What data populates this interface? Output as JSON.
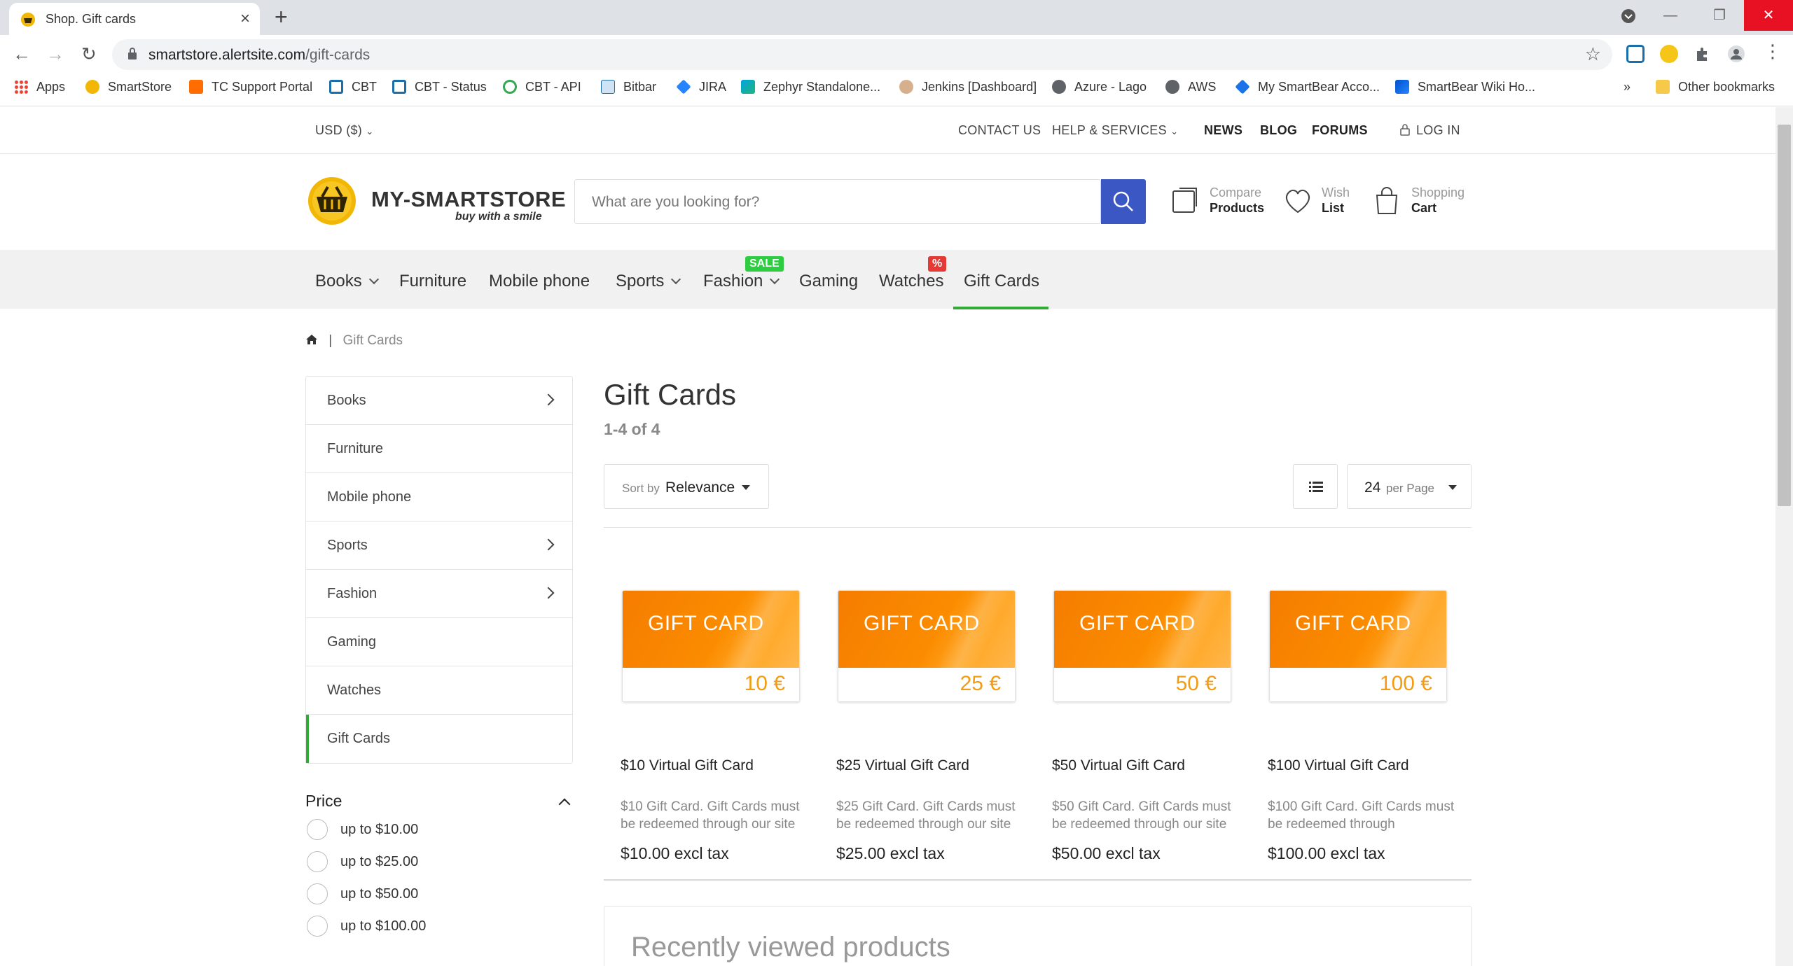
{
  "browser": {
    "tab_title": "Shop. Gift cards",
    "url_host": "smartstore.alertsite.com",
    "url_path": "/gift-cards",
    "bookmarks": [
      "Apps",
      "SmartStore",
      "TC Support Portal",
      "CBT",
      "CBT - Status",
      "CBT - API",
      "Bitbar",
      "JIRA",
      "Zephyr Standalone...",
      "Jenkins [Dashboard]",
      "Azure - Lago",
      "AWS",
      "My SmartBear Acco...",
      "SmartBear Wiki Ho..."
    ],
    "overflow": "»",
    "other_bookmarks": "Other bookmarks"
  },
  "topbar": {
    "currency": "USD ($)",
    "contact": "CONTACT US",
    "help": "HELP & SERVICES",
    "news": "NEWS",
    "blog": "BLOG",
    "forums": "FORUMS",
    "login": "LOG IN"
  },
  "header": {
    "logo_name": "MY-SMARTSTORE",
    "logo_tagline": "buy with a smile",
    "search_placeholder": "What are you looking for?",
    "compare_l1": "Compare",
    "compare_l2": "Products",
    "wish_l1": "Wish",
    "wish_l2": "List",
    "cart_l1": "Shopping",
    "cart_l2": "Cart"
  },
  "nav": {
    "books": "Books",
    "furniture": "Furniture",
    "mobile": "Mobile phone",
    "sports": "Sports",
    "fashion": "Fashion",
    "fashion_badge": "SALE",
    "gaming": "Gaming",
    "watches": "Watches",
    "watches_badge": "%",
    "giftcards": "Gift Cards"
  },
  "breadcrumb": {
    "sep": "|",
    "current": "Gift Cards"
  },
  "sidebar": {
    "items": [
      "Books",
      "Furniture",
      "Mobile phone",
      "Sports",
      "Fashion",
      "Gaming",
      "Watches",
      "Gift Cards"
    ]
  },
  "price_filter": {
    "title": "Price",
    "options": [
      "up to $10.00",
      "up to $25.00",
      "up to $50.00",
      "up to $100.00"
    ]
  },
  "main": {
    "title": "Gift Cards",
    "count": "1-4 of 4",
    "sort_prefix": "Sort by",
    "sort_value": "Relevance",
    "per_page_num": "24",
    "per_page_label": "per Page",
    "recent_title": "Recently viewed products"
  },
  "card_text": "GIFT CARD",
  "products": [
    {
      "amount": "10 €",
      "name": "$10 Virtual Gift Card",
      "desc": "$10 Gift Card. Gift Cards must be redeemed through our site",
      "price": "$10.00 excl tax"
    },
    {
      "amount": "25 €",
      "name": "$25 Virtual Gift Card",
      "desc": "$25 Gift Card. Gift Cards must be redeemed through our site",
      "price": "$25.00 excl tax"
    },
    {
      "amount": "50 €",
      "name": "$50 Virtual Gift Card",
      "desc": "$50 Gift Card. Gift Cards must be redeemed through our site",
      "price": "$50.00 excl tax"
    },
    {
      "amount": "100 €",
      "name": "$100 Virtual Gift Card",
      "desc": "$100 Gift Card. Gift Cards must be redeemed through",
      "price": "$100.00 excl tax"
    }
  ],
  "colors": {
    "accent": "#3a57c4",
    "active": "#33aa33",
    "sale": "#2ecc40",
    "percent": "#e53935",
    "card": "#fb8c00"
  }
}
